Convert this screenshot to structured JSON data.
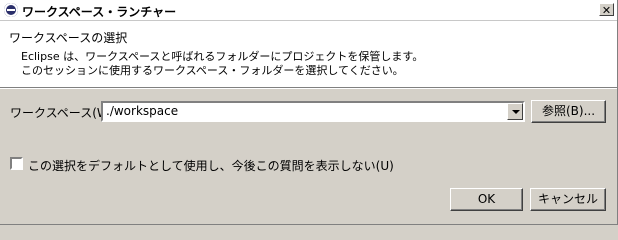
{
  "window": {
    "title": "ワークスペース・ランチャー",
    "close_symbol": "✕"
  },
  "header": {
    "title": "ワークスペースの選択",
    "description_line1": "Eclipse は、ワークスペースと呼ばれるフォルダーにプロジェクトを保管します。",
    "description_line2": "このセッションに使用するワークスペース・フォルダーを選択してください。"
  },
  "workspace": {
    "label": "ワークスペース(W):",
    "value": "./workspace",
    "browse_label": "参照(B)..."
  },
  "options": {
    "default_checkbox_label": "この選択をデフォルトとして使用し、今後この質問を表示しない(U)",
    "default_checked": false
  },
  "buttons": {
    "ok_label": "OK",
    "cancel_label": "キャンセル"
  },
  "icons": {
    "app_icon": "eclipse-icon",
    "close_icon": "close-icon",
    "dropdown_icon": "chevron-down-icon"
  },
  "colors": {
    "dialog_background": "#d4d0c8",
    "header_background": "#ffffff"
  }
}
